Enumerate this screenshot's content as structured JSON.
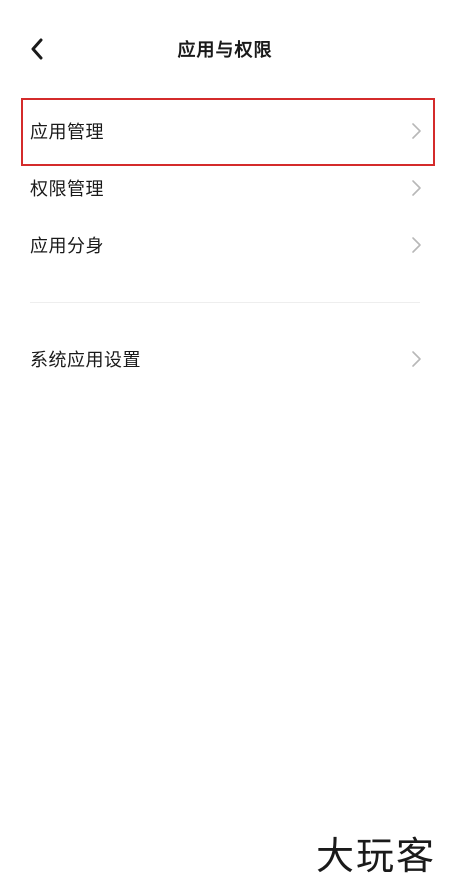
{
  "header": {
    "title": "应用与权限",
    "back_icon": "chevron-left-icon"
  },
  "menu": {
    "items": [
      {
        "label": "应用管理",
        "icon": "chevron-right-icon",
        "highlighted": true
      },
      {
        "label": "权限管理",
        "icon": "chevron-right-icon",
        "highlighted": false
      },
      {
        "label": "应用分身",
        "icon": "chevron-right-icon",
        "highlighted": false
      }
    ]
  },
  "menu2": {
    "items": [
      {
        "label": "系统应用设置",
        "icon": "chevron-right-icon",
        "highlighted": false
      }
    ]
  },
  "annotation": {
    "highlight_color": "#d42b2b"
  },
  "watermark": {
    "text": "大玩客"
  },
  "colors": {
    "background": "#ffffff",
    "text": "#1a1a1a",
    "chevron": "#b8b8b8",
    "divider": "#eeeeee"
  }
}
